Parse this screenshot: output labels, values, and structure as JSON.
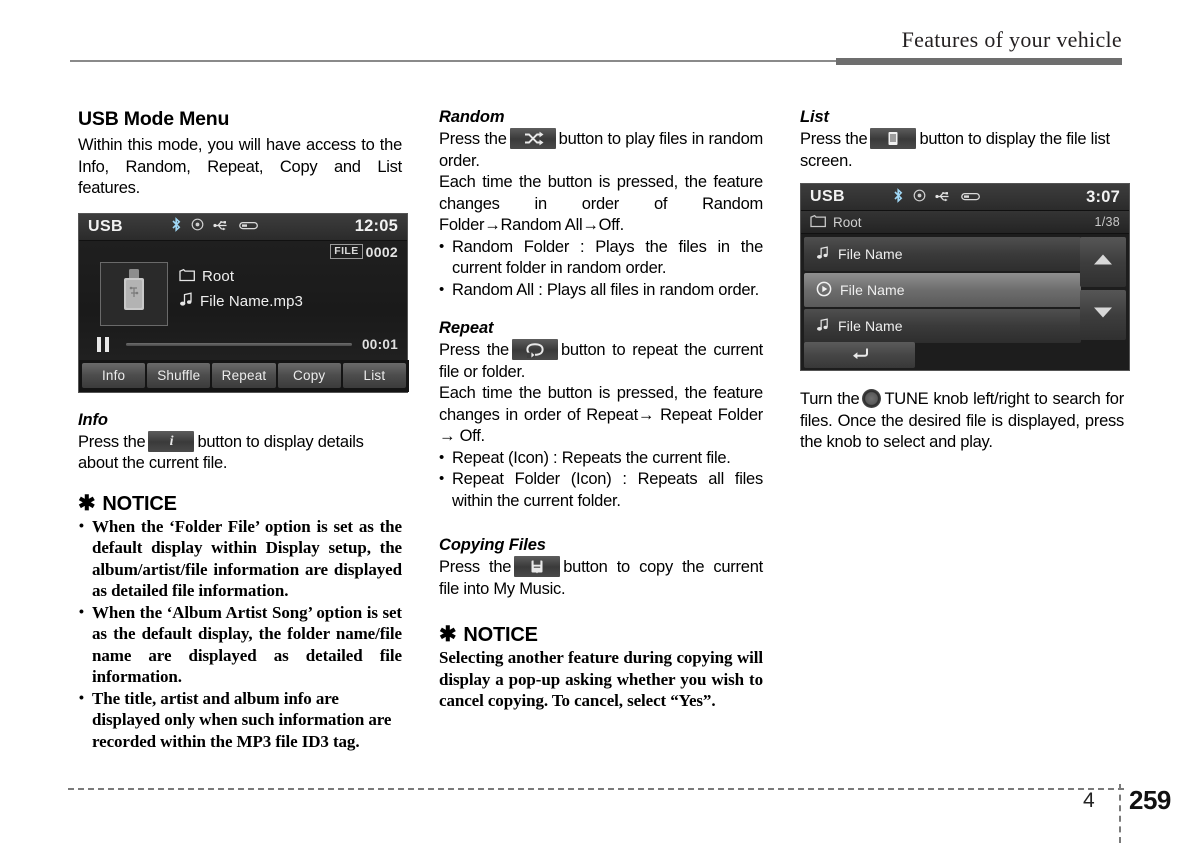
{
  "header": {
    "title": "Features of your vehicle"
  },
  "footer": {
    "chapter": "4",
    "page": "259"
  },
  "left_column": {
    "section_title": "USB Mode Menu",
    "intro": "Within this mode, you will have access to the Info, Random, Repeat, Copy and List features.",
    "player_screen": {
      "source": "USB",
      "clock": "12:05",
      "status_icons": [
        "bluetooth-icon",
        "disc-icon",
        "usb-trident-icon",
        "usb-plug-icon"
      ],
      "file_badge_label": "FILE",
      "file_badge_number": "0002",
      "folder": "Root",
      "file": "File Name.mp3",
      "elapsed": "00:01",
      "transport_state": "pause",
      "softkeys": [
        "Info",
        "Shuffle",
        "Repeat",
        "Copy",
        "List"
      ]
    },
    "info": {
      "title": "Info",
      "text_before": "Press the",
      "button_icon": "info-i-icon",
      "text_after": "button to display details about the current file."
    },
    "notice": {
      "star": "✱",
      "heading": "NOTICE",
      "items": [
        "When the ‘Folder File’ option is set as the default display within Display setup, the album/artist/file information are displayed as detailed file information.",
        "When the ‘Album Artist Song’ option is set as the default display, the folder name/file name are displayed as detailed file information.",
        "The title, artist and album info are displayed only when such information are recorded within the MP3 file ID3 tag."
      ]
    }
  },
  "middle_column": {
    "random": {
      "title": "Random",
      "text_before": "Press the",
      "button_icon": "shuffle-icon",
      "text_after": "button to play files in random order.",
      "paragraph2": "Each time the button is pressed, the feature changes in order of Random Folder→Random All→Off.",
      "items": [
        "Random Folder : Plays the files in the current folder in random order.",
        "Random All : Plays all files in random order."
      ]
    },
    "repeat": {
      "title": "Repeat",
      "text_before": "Press the",
      "button_icon": "repeat-loop-icon",
      "text_after": "button to repeat the current file or folder.",
      "paragraph2": "Each time the button is pressed, the feature changes in order of Repeat→ Repeat Folder → Off.",
      "items": [
        "Repeat (Icon) : Repeats the current file.",
        "Repeat Folder (Icon) : Repeats all files within the current folder."
      ]
    },
    "copying": {
      "title": "Copying Files",
      "text_before": "Press the",
      "button_icon": "copy-save-icon",
      "text_after": "button to copy the current file into My Music."
    },
    "notice": {
      "star": "✱",
      "heading": "NOTICE",
      "body": "Selecting another feature during copying will display a pop-up asking whether you wish to cancel copying. To cancel, select “Yes”."
    }
  },
  "right_column": {
    "list": {
      "title": "List",
      "text_before": "Press the",
      "button_icon": "list-lines-icon",
      "text_after": "button to display the file list screen."
    },
    "list_screen": {
      "source": "USB",
      "clock": "3:07",
      "status_icons": [
        "bluetooth-icon",
        "disc-icon",
        "usb-trident-icon",
        "usb-plug-icon"
      ],
      "folder": "Root",
      "counter": "1/38",
      "rows": [
        {
          "label": "File Name",
          "icon": "music-note-icon",
          "selected": false
        },
        {
          "label": "File Name",
          "icon": "play-circle-icon",
          "selected": true
        },
        {
          "label": "File Name",
          "icon": "music-note-icon",
          "selected": false
        }
      ],
      "scroll_up_icon": "triangle-up-icon",
      "scroll_down_icon": "triangle-down-icon",
      "back_icon": "back-arrow-icon"
    },
    "tune_text_before": "Turn the",
    "tune_knob_icon": "tune-knob-icon",
    "tune_text_after": "TUNE knob left/right to search for files. Once the desired file is displayed, press the knob to select and play."
  }
}
